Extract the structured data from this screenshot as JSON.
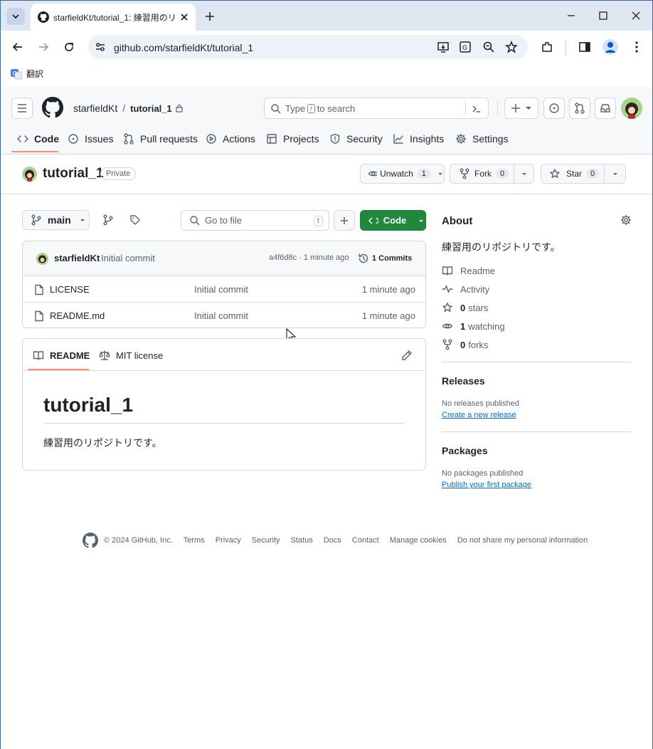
{
  "browser": {
    "tab_title": "starfieldKt/tutorial_1: 練習用のリ",
    "url": "github.com/starfieldKt/tutorial_1",
    "bookmark_label": "翻訳"
  },
  "header": {
    "owner": "starfieldKt",
    "separator": "/",
    "repo": "tutorial_1",
    "search_prefix": "Type",
    "search_key": "/",
    "search_suffix": "to search"
  },
  "repo_nav": [
    {
      "label": "Code"
    },
    {
      "label": "Issues"
    },
    {
      "label": "Pull requests"
    },
    {
      "label": "Actions"
    },
    {
      "label": "Projects"
    },
    {
      "label": "Security"
    },
    {
      "label": "Insights"
    },
    {
      "label": "Settings"
    }
  ],
  "repo_bar": {
    "name": "tutorial_1",
    "visibility": "Private",
    "unwatch_label": "Unwatch",
    "watch_count": "1",
    "fork_label": "Fork",
    "fork_count": "0",
    "star_label": "Star",
    "star_count": "0"
  },
  "file_toolbar": {
    "branch": "main",
    "go_to_file_placeholder": "Go to file",
    "go_to_file_key": "t",
    "code_button": "Code"
  },
  "commit": {
    "author": "starfieldKt",
    "message": "Initial commit",
    "hash_time": "a4f6d8c · 1 minute ago",
    "commits_label": "1 Commits"
  },
  "files": [
    {
      "name": "LICENSE",
      "message": "Initial commit",
      "time": "1 minute ago"
    },
    {
      "name": "README.md",
      "message": "Initial commit",
      "time": "1 minute ago"
    }
  ],
  "readme": {
    "tab_readme": "README",
    "tab_license": "MIT license",
    "heading": "tutorial_1",
    "body": "練習用のリポジトリです。"
  },
  "about": {
    "title": "About",
    "description": "練習用のリポジトリです。",
    "readme": "Readme",
    "activity": "Activity",
    "stars_count": "0",
    "stars_label": "stars",
    "watching_count": "1",
    "watching_label": "watching",
    "forks_count": "0",
    "forks_label": "forks"
  },
  "releases": {
    "title": "Releases",
    "none": "No releases published",
    "link": "Create a new release"
  },
  "packages": {
    "title": "Packages",
    "none": "No packages published",
    "link": "Publish your first package"
  },
  "footer": {
    "copyright": "© 2024 GitHub, Inc.",
    "links": [
      "Terms",
      "Privacy",
      "Security",
      "Status",
      "Docs",
      "Contact",
      "Manage cookies",
      "Do not share my personal information"
    ]
  },
  "colors": {
    "accent_orange": "#fd8c73",
    "code_green": "#1f883d",
    "link_blue": "#0969da"
  }
}
